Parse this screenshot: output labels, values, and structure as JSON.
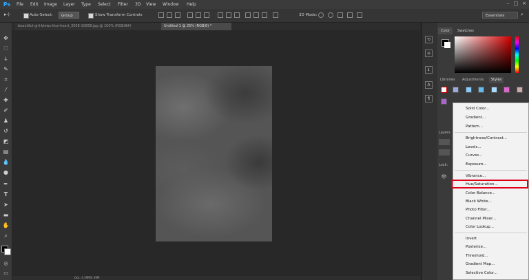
{
  "app": {
    "logo": "Ps"
  },
  "menubar": {
    "items": [
      "File",
      "Edit",
      "Image",
      "Layer",
      "Type",
      "Select",
      "Filter",
      "3D",
      "View",
      "Window",
      "Help"
    ],
    "window_controls": [
      "–",
      "□",
      "×"
    ]
  },
  "options": {
    "auto_select_label": "Auto-Select:",
    "group_value": "Group",
    "show_transform_label": "Show Transform Controls",
    "mode_3d_label": "3D Mode:",
    "workspace": "Essentials"
  },
  "tabs": [
    {
      "label": "beautiful-girl-blows-kiss-heart_3058-10858.jpg @ 100% (RGB/8#)"
    },
    {
      "label": "Untitled-1 @ 25% (RGB/8) *"
    }
  ],
  "status": {
    "text": "Doc: 4.39M/4.39M"
  },
  "panels": {
    "color_tabs": [
      "Color",
      "Swatches"
    ],
    "library_tabs": [
      "Libraries",
      "Adjustments",
      "Styles"
    ],
    "layers_label": "Layers",
    "lock_label": "Lock:",
    "colors": {
      "fg": "#000000",
      "bg": "#ffffff",
      "hue": "#d40000",
      "highlight": "#e0001a"
    }
  },
  "dropdown": {
    "items": [
      "Solid Color...",
      "Gradient...",
      "Pattern...",
      "Brightness/Contrast...",
      "Levels...",
      "Curves...",
      "Exposure...",
      "Vibrance...",
      "Hue/Saturation...",
      "Color Balance...",
      "Black White...",
      "Photo Filter...",
      "Channel Mixer...",
      "Color Lookup...",
      "Invert",
      "Posterize...",
      "Threshold...",
      "Gradient Map...",
      "Selective Color..."
    ],
    "highlighted": "Hue/Saturation..."
  },
  "icons": [
    "move-icon",
    "marquee-icon",
    "lasso-icon",
    "quick-select-icon",
    "crop-icon",
    "eyedropper-icon",
    "healing-icon",
    "brush-icon",
    "stamp-icon",
    "history-brush-icon",
    "eraser-icon",
    "gradient-icon",
    "blur-icon",
    "dodge-icon",
    "pen-icon",
    "type-icon",
    "path-select-icon",
    "shape-icon",
    "hand-icon",
    "zoom-icon"
  ]
}
